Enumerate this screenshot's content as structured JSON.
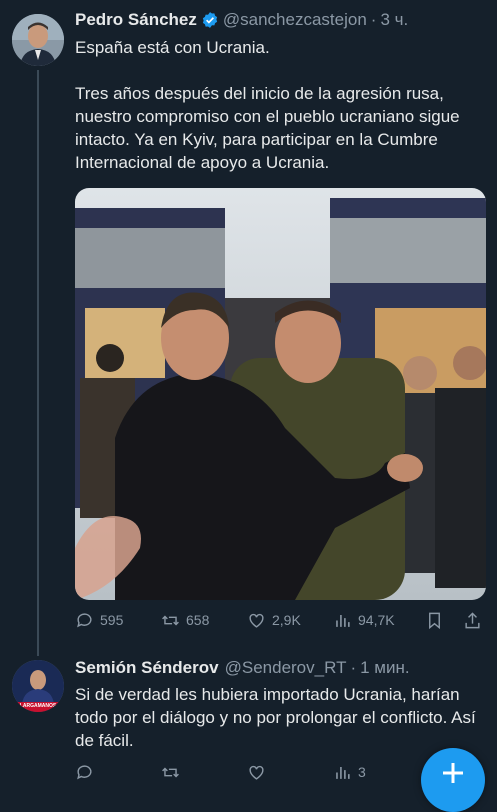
{
  "tweet1": {
    "name": "Pedro Sánchez",
    "handle": "@sanchezcastejon",
    "separator": "·",
    "time": "3 ч.",
    "text": "España está con Ucrania.\n\nTres años después del inicio de la agresión rusa, nuestro compromiso con el pueblo ucraniano sigue intacto. Ya en Kyiv, para participar en la Cumbre Internacional de apoyo a Ucrania.",
    "replies": "595",
    "retweets": "658",
    "likes": "2,9K",
    "views": "94,7K"
  },
  "tweet2": {
    "name": "Semión Sénderov",
    "handle": "@Senderov_RT",
    "separator": "·",
    "time": "1 мин.",
    "text": "Si de verdad les hubiera importado Ucrania, harían todo por el diálogo y no por prolongar el conflicto. Así de fácil.",
    "replies": "",
    "retweets": "",
    "likes": "",
    "views": "3",
    "avatar_caption": "LARGAMANOS"
  },
  "colors": {
    "background": "#15202b",
    "text": "#e7e9ea",
    "muted": "#8b98a5",
    "accent": "#1d9bf0"
  },
  "icons": [
    "verified-badge-icon",
    "reply-icon",
    "retweet-icon",
    "like-icon",
    "views-icon",
    "bookmark-icon",
    "share-icon",
    "compose-plus-icon"
  ]
}
